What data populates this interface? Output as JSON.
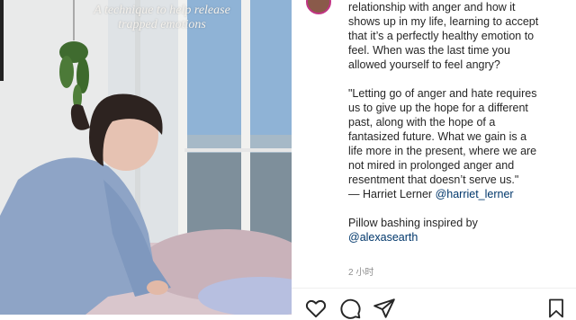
{
  "overlay": {
    "line1": "A technique to help release",
    "line2": "trapped emotions"
  },
  "caption": {
    "lines": [
      "relationship with anger and how it",
      "shows up in my life, learning to accept",
      "that it’s a perfectly healthy emotion to",
      "feel. When was the last time you",
      "allowed yourself to feel angry?"
    ],
    "quote_lines": [
      "\"Letting go of anger and hate requires",
      "us to give up the hope for a different",
      "past, along with the hope of a",
      "fantasized future. What we gain is a",
      "life more in the present, where we are",
      "not mired in prolonged anger and",
      "resentment that doesn’t serve us.\""
    ],
    "attribution_prefix": "— Harriet Lerner ",
    "attribution_mention": "@harriet_lerner",
    "credit_line": "Pillow bashing inspired by",
    "credit_mention": "@alexasearth"
  },
  "time": "2 小时",
  "icons": {
    "like": "heart-icon",
    "comment": "comment-icon",
    "share": "paper-plane-icon",
    "save": "bookmark-icon"
  }
}
